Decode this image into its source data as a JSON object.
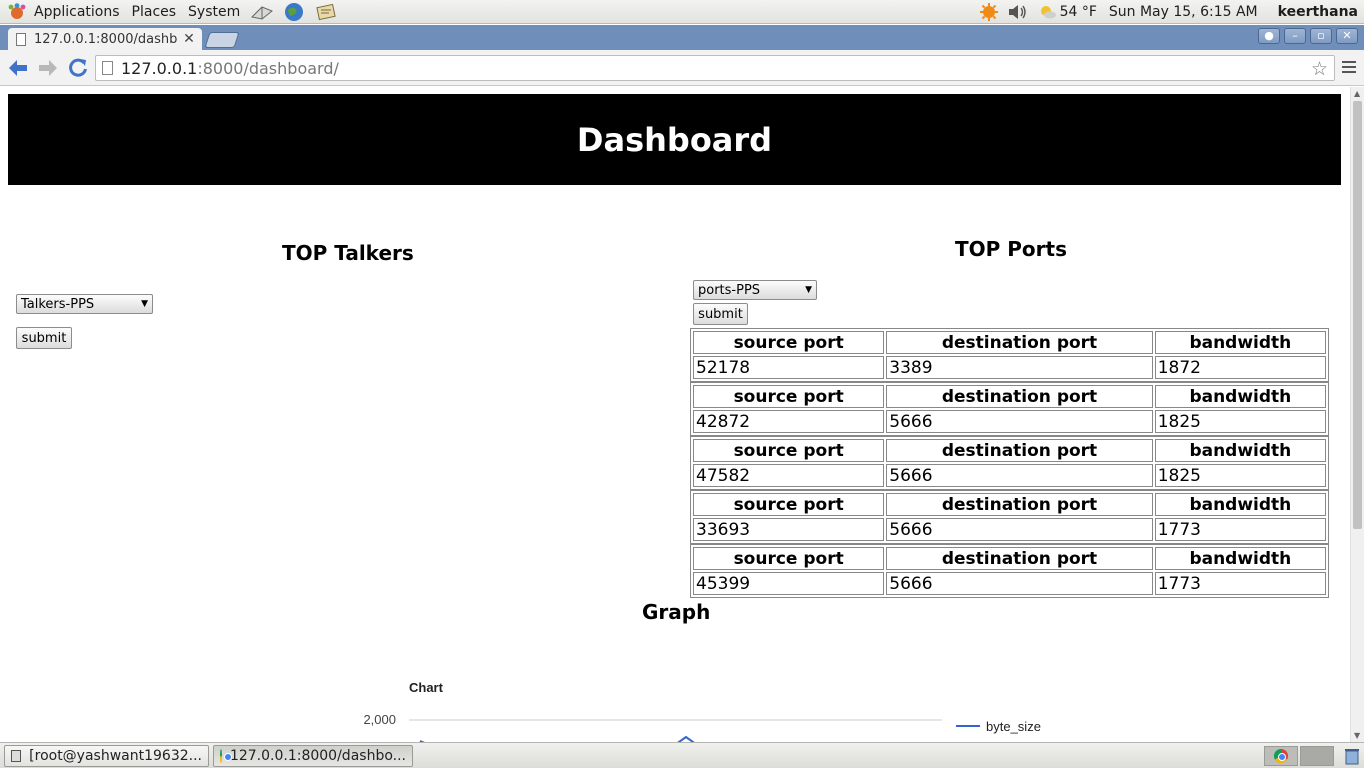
{
  "panel": {
    "applications": "Applications",
    "places": "Places",
    "system": "System",
    "weather": "54 °F",
    "datetime": "Sun May 15,  6:15 AM",
    "user": "keerthana"
  },
  "browser": {
    "tab_title": "127.0.0.1:8000/dashb",
    "url_host": "127.0.0.1",
    "url_rest": ":8000/dashboard/"
  },
  "page": {
    "header": "Dashboard",
    "talkers": {
      "title": "TOP Talkers",
      "select_value": "Talkers-PPS",
      "submit": "submit"
    },
    "ports": {
      "title": "TOP Ports",
      "select_value": "ports-PPS",
      "submit": "submit",
      "headers": [
        "source port",
        "destination port",
        "bandwidth"
      ],
      "rows": [
        {
          "src": "52178",
          "dst": "3389",
          "bw": "1872"
        },
        {
          "src": "42872",
          "dst": "5666",
          "bw": "1825"
        },
        {
          "src": "47582",
          "dst": "5666",
          "bw": "1825"
        },
        {
          "src": "33693",
          "dst": "5666",
          "bw": "1773"
        },
        {
          "src": "45399",
          "dst": "5666",
          "bw": "1773"
        }
      ]
    },
    "graph_title": "Graph"
  },
  "chart_data": {
    "type": "line",
    "title": "Chart",
    "yticks": [
      "2,000"
    ],
    "legend_position": "right",
    "series": [
      {
        "name": "byte_size",
        "color": "#3366cc"
      }
    ]
  },
  "taskbar": {
    "terminal": "[root@yashwant19632...",
    "browser": "127.0.0.1:8000/dashbo..."
  },
  "colors": {
    "banner": "#000000",
    "tab_strip": "#6f8fba",
    "series": "#3366cc"
  }
}
